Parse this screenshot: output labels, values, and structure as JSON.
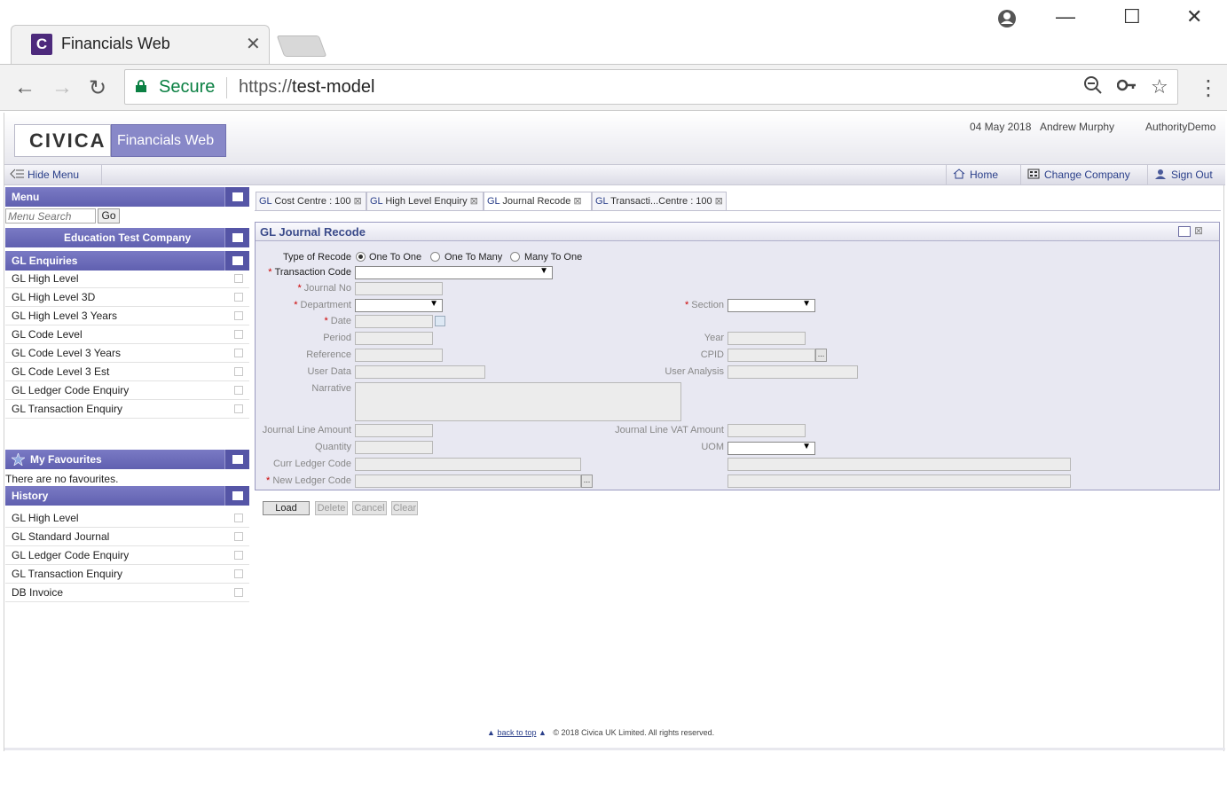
{
  "browser": {
    "tab_title": "Financials Web",
    "favicon_letter": "C",
    "secure_label": "Secure",
    "url_scheme": "https://",
    "url_host": "test-model"
  },
  "header": {
    "logo": "CIVICA",
    "app_name": "Financials Web",
    "date": "04 May 2018",
    "user": "Andrew Murphy",
    "authority": "AuthorityDemo"
  },
  "toolbar": {
    "hide_menu": "Hide Menu",
    "home": "Home",
    "change_company": "Change Company",
    "sign_out": "Sign Out"
  },
  "menu": {
    "title": "Menu",
    "search_placeholder": "Menu Search",
    "go_label": "Go",
    "company": "Education Test Company",
    "section": "GL Enquiries",
    "items": [
      "GL High Level",
      "GL High Level 3D",
      "GL High Level 3 Years",
      "GL Code Level",
      "GL Code Level 3 Years",
      "GL Code Level 3 Est",
      "GL Ledger Code Enquiry",
      "GL Transaction Enquiry"
    ],
    "favourites_title": "My Favourites",
    "favourites_empty": "There are no favourites.",
    "history_title": "History",
    "history_items": [
      "GL High Level",
      "GL Standard Journal",
      "GL Ledger Code Enquiry",
      "GL Transaction Enquiry",
      "DB Invoice"
    ]
  },
  "tabs": [
    {
      "prefix": "GL",
      "label": "Cost Centre : 100"
    },
    {
      "prefix": "GL",
      "label": "High Level Enquiry"
    },
    {
      "prefix": "GL",
      "label": "Journal Recode"
    },
    {
      "prefix": "GL",
      "label": "Transacti...Centre : 100"
    }
  ],
  "form": {
    "title": "GL Journal Recode",
    "type_of_recode": "Type of Recode",
    "radio_options": [
      "One To One",
      "One To Many",
      "Many To One"
    ],
    "transaction_code": "Transaction Code",
    "journal_no": "Journal No",
    "department": "Department",
    "section": "Section",
    "date": "Date",
    "period": "Period",
    "year": "Year",
    "reference": "Reference",
    "cpid": "CPID",
    "user_data": "User Data",
    "user_analysis": "User Analysis",
    "narrative": "Narrative",
    "journal_line_amount": "Journal Line Amount",
    "journal_line_vat_amount": "Journal Line VAT Amount",
    "quantity": "Quantity",
    "uom": "UOM",
    "curr_ledger_code": "Curr Ledger Code",
    "new_ledger_code": "New Ledger Code",
    "ellipsis": "...",
    "buttons": {
      "load": "Load",
      "delete": "Delete",
      "cancel": "Cancel",
      "clear": "Clear"
    }
  },
  "footer": {
    "back_to_top": "back to top",
    "copyright": "© 2018 Civica UK Limited. All rights reserved."
  },
  "colors": {
    "accent": "#6a6ab8",
    "link": "#2a3f8a",
    "secure": "#0b8043",
    "required": "#cc0000"
  }
}
